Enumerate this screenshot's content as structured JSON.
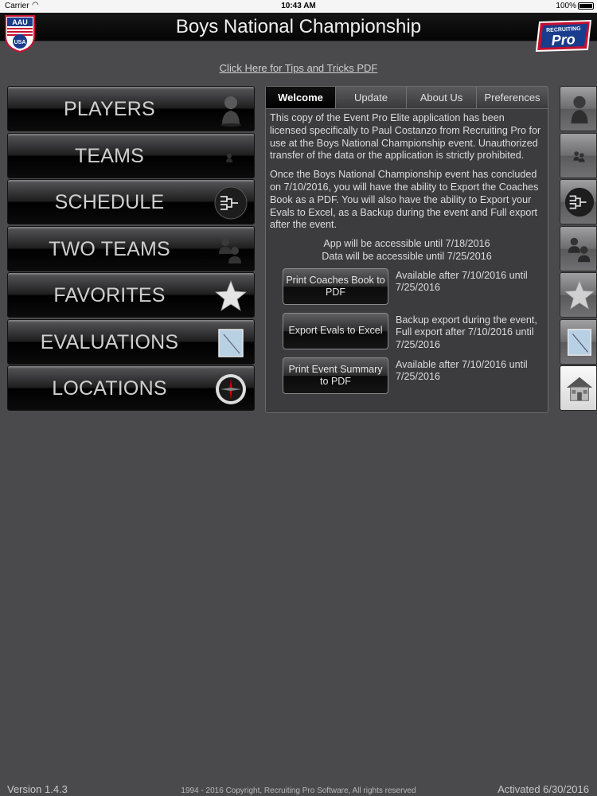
{
  "status_bar": {
    "carrier": "Carrier",
    "time": "10:43 AM",
    "battery": "100%"
  },
  "header": {
    "title": "Boys National Championship",
    "left_logo_text_top": "AAU",
    "left_logo_text_bottom": "USA",
    "right_logo_text_top": "RECRUITING",
    "right_logo_text_main": "Pro"
  },
  "tips_link": "Click Here for Tips and Tricks PDF",
  "menu": [
    {
      "label": "PLAYERS",
      "icon": "player-icon"
    },
    {
      "label": "TEAMS",
      "icon": "team-icon"
    },
    {
      "label": "SCHEDULE",
      "icon": "bracket-icon"
    },
    {
      "label": "TWO TEAMS",
      "icon": "two-teams-icon"
    },
    {
      "label": "FAVORITES",
      "icon": "star-icon"
    },
    {
      "label": "EVALUATIONS",
      "icon": "notebook-icon"
    },
    {
      "label": "LOCATIONS",
      "icon": "compass-icon"
    }
  ],
  "tabs": [
    {
      "label": "Welcome",
      "active": true
    },
    {
      "label": "Update",
      "active": false
    },
    {
      "label": "About Us",
      "active": false
    },
    {
      "label": "Preferences",
      "active": false
    }
  ],
  "welcome": {
    "para1": "This copy of the Event Pro Elite application has been licensed specifically to Paul Costanzo from Recruiting Pro for use at the Boys National Championship event. Unauthorized transfer of the data or the application is strictly prohibited.",
    "para2": "Once the Boys National Championship event has concluded on 7/10/2016, you will have the ability to Export the Coaches Book as a PDF.  You will also have the ability to Export your Evals to Excel, as a Backup during the event and Full export after the event.",
    "app_access": "App will be accessible until 7/18/2016",
    "data_access": "Data will be accessible until 7/25/2016"
  },
  "actions": [
    {
      "button": "Print Coaches Book to PDF",
      "desc": "Available after 7/10/2016 until 7/25/2016"
    },
    {
      "button": "Export Evals to Excel",
      "desc": "Backup export during the event, Full export after 7/10/2016 until 7/25/2016"
    },
    {
      "button": "Print Event Summary to PDF",
      "desc": "Available after 7/10/2016 until 7/25/2016"
    }
  ],
  "strip": [
    {
      "icon": "player-icon",
      "active": false
    },
    {
      "icon": "team-icon",
      "active": false
    },
    {
      "icon": "bracket-icon",
      "active": false
    },
    {
      "icon": "two-teams-icon",
      "active": false
    },
    {
      "icon": "star-icon",
      "active": false
    },
    {
      "icon": "notebook-icon",
      "active": false
    },
    {
      "icon": "home-icon",
      "active": true
    }
  ],
  "footer": {
    "version": "Version 1.4.3",
    "copyright": "1994 - 2016 Copyright, Recruiting Pro Software, All rights reserved",
    "activated": "Activated 6/30/2016"
  }
}
